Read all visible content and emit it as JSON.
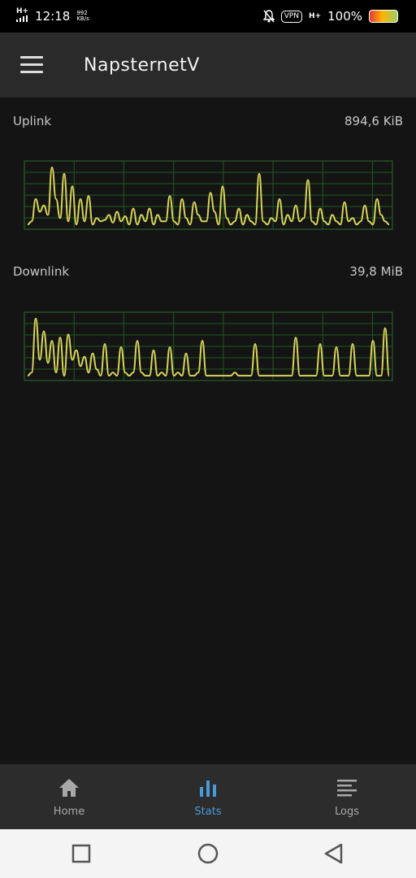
{
  "status_bar": {
    "network_type": "H+",
    "time": "12:18",
    "speed_value": "992",
    "speed_unit": "KB/s",
    "vpn": "VPN",
    "network_type_right": "H+",
    "battery": "100%"
  },
  "app_bar": {
    "title": "NapsternetV"
  },
  "stats": {
    "uplink": {
      "label": "Uplink",
      "value": "894,6  KiB",
      "color": "#d9d45a",
      "chart_data": {
        "type": "line",
        "x": [
          0,
          1,
          2,
          3,
          4,
          5,
          6,
          7,
          8,
          9,
          10,
          11,
          12,
          13,
          14,
          15,
          16,
          17,
          18,
          19,
          20,
          21,
          22,
          23,
          24,
          25,
          26,
          27,
          28,
          29,
          30,
          31,
          32,
          33,
          34,
          35,
          36,
          37,
          38,
          39,
          40,
          41,
          42,
          43,
          44,
          45,
          46,
          47,
          48,
          49,
          50,
          51,
          52,
          53,
          54,
          55,
          56,
          57,
          58,
          59,
          60,
          61,
          62,
          63,
          64,
          65,
          66,
          67,
          68,
          69,
          70,
          71,
          72,
          73,
          74,
          75,
          76,
          77,
          78,
          79,
          80,
          81,
          82,
          83,
          84,
          85,
          86,
          87,
          88,
          89
        ],
        "values": [
          0.05,
          0.1,
          0.45,
          0.25,
          0.35,
          0.2,
          0.95,
          0.45,
          0.15,
          0.85,
          0.1,
          0.65,
          0.05,
          0.45,
          0.1,
          0.5,
          0.05,
          0.15,
          0.1,
          0.12,
          0.2,
          0.08,
          0.25,
          0.1,
          0.18,
          0.05,
          0.3,
          0.05,
          0.2,
          0.1,
          0.3,
          0.05,
          0.2,
          0.1,
          0.1,
          0.5,
          0.1,
          0.05,
          0.45,
          0.15,
          0.05,
          0.4,
          0.2,
          0.1,
          0.1,
          0.55,
          0.25,
          0.05,
          0.65,
          0.15,
          0.05,
          0.1,
          0.3,
          0.05,
          0.2,
          0.1,
          0.05,
          0.85,
          0.1,
          0.05,
          0.15,
          0.1,
          0.45,
          0.05,
          0.2,
          0.1,
          0.35,
          0.1,
          0.15,
          0.75,
          0.1,
          0.05,
          0.3,
          0.1,
          0.05,
          0.2,
          0.1,
          0.05,
          0.4,
          0.1,
          0.15,
          0.05,
          0.1,
          0.35,
          0.1,
          0.05,
          0.45,
          0.2,
          0.1,
          0.05
        ],
        "ylim": [
          0,
          1
        ],
        "grid": true
      }
    },
    "downlink": {
      "label": "Downlink",
      "value": "39,8  MiB",
      "color": "#d9d45a",
      "chart_data": {
        "type": "line",
        "x": [
          0,
          1,
          2,
          3,
          4,
          5,
          6,
          7,
          8,
          9,
          10,
          11,
          12,
          13,
          14,
          15,
          16,
          17,
          18,
          19,
          20,
          21,
          22,
          23,
          24,
          25,
          26,
          27,
          28,
          29,
          30,
          31,
          32,
          33,
          34,
          35,
          36,
          37,
          38,
          39,
          40,
          41,
          42,
          43,
          44,
          45,
          46,
          47,
          48,
          49,
          50,
          51,
          52,
          53,
          54,
          55,
          56,
          57,
          58,
          59,
          60,
          61,
          62,
          63,
          64,
          65,
          66,
          67,
          68,
          69,
          70,
          71,
          72,
          73,
          74,
          75,
          76,
          77,
          78,
          79,
          80,
          81,
          82,
          83,
          84,
          85,
          86,
          87,
          88,
          89
        ],
        "values": [
          0.05,
          0.1,
          0.95,
          0.3,
          0.75,
          0.25,
          0.6,
          0.1,
          0.65,
          0.05,
          0.7,
          0.3,
          0.45,
          0.2,
          0.35,
          0.1,
          0.4,
          0.15,
          0.05,
          0.55,
          0.05,
          0.1,
          0.05,
          0.5,
          0.1,
          0.05,
          0.1,
          0.6,
          0.1,
          0.05,
          0.05,
          0.45,
          0.05,
          0.1,
          0.05,
          0.5,
          0.05,
          0.1,
          0.05,
          0.4,
          0.05,
          0.05,
          0.1,
          0.6,
          0.05,
          0.05,
          0.05,
          0.05,
          0.05,
          0.05,
          0.05,
          0.1,
          0.05,
          0.05,
          0.05,
          0.05,
          0.55,
          0.05,
          0.05,
          0.05,
          0.05,
          0.05,
          0.05,
          0.05,
          0.05,
          0.05,
          0.65,
          0.05,
          0.05,
          0.05,
          0.05,
          0.05,
          0.55,
          0.05,
          0.05,
          0.05,
          0.5,
          0.05,
          0.05,
          0.05,
          0.55,
          0.05,
          0.05,
          0.05,
          0.05,
          0.6,
          0.05,
          0.05,
          0.8,
          0.05
        ],
        "ylim": [
          0,
          1
        ],
        "grid": true
      }
    }
  },
  "bottom_nav": {
    "items": [
      {
        "label": "Home",
        "icon": "home-icon",
        "active": false
      },
      {
        "label": "Stats",
        "icon": "bar-chart-icon",
        "active": true
      },
      {
        "label": "Logs",
        "icon": "list-icon",
        "active": false
      }
    ],
    "active_color": "#4b9ad8"
  },
  "system_nav": {
    "buttons": [
      "recents-icon",
      "home-circle-icon",
      "back-icon"
    ]
  }
}
